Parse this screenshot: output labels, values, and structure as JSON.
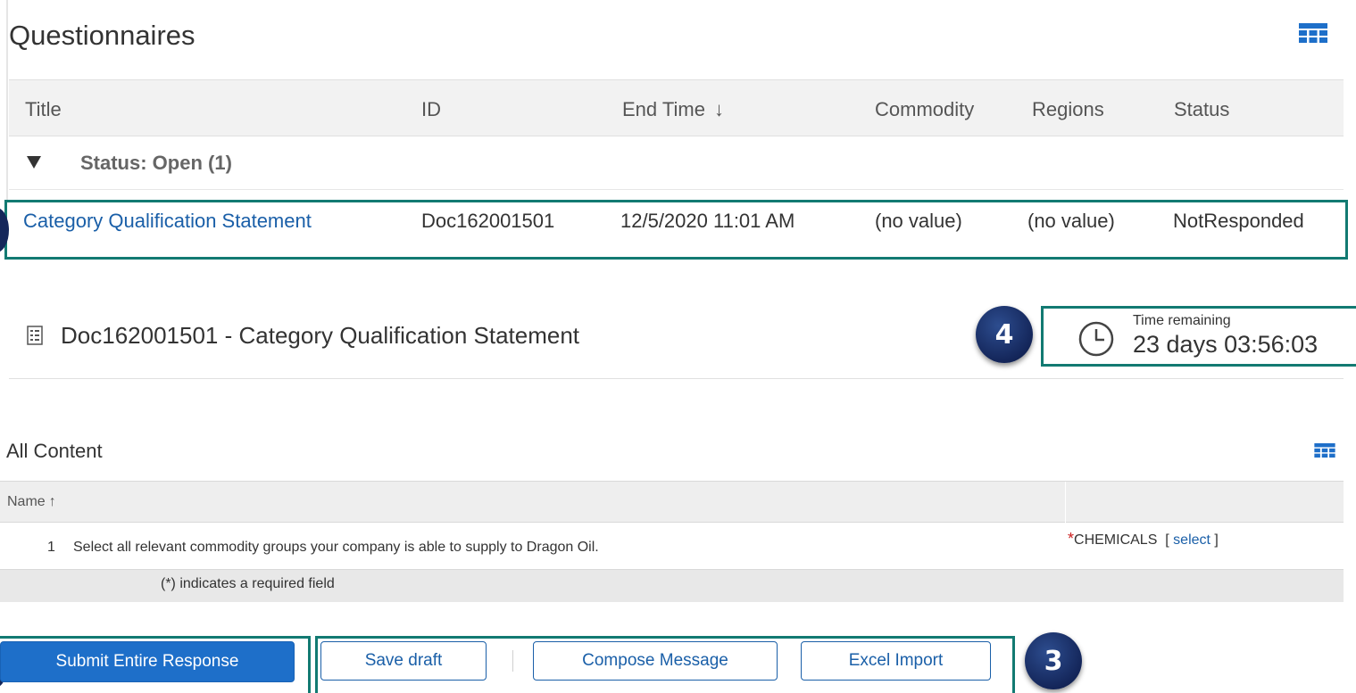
{
  "questionnaires": {
    "title": "Questionnaires",
    "columns": [
      {
        "label": "Title"
      },
      {
        "label": "ID"
      },
      {
        "label": "End Time",
        "sort": "descending"
      },
      {
        "label": "Commodity"
      },
      {
        "label": "Regions"
      },
      {
        "label": "Status"
      }
    ],
    "group": {
      "label": "Status: Open (1)",
      "expanded": true
    },
    "rows": [
      {
        "title": "Category Qualification Statement",
        "id": "Doc162001501",
        "end_time": "12/5/2020 11:01 AM",
        "commodity": "(no value)",
        "regions": "(no value)",
        "status": "NotResponded"
      }
    ]
  },
  "document": {
    "title": "Doc162001501 - Category Qualification Statement",
    "time_remaining_label": "Time remaining",
    "time_remaining_value": "23 days 03:56:03"
  },
  "all_content": {
    "title": "All Content",
    "column_name": "Name",
    "items": [
      {
        "number": "1",
        "question": "Select all relevant commodity groups your company is able to supply to Dragon Oil.",
        "required_marker": "*",
        "answer": "CHEMICALS",
        "select_open": "[",
        "select_label": "select",
        "select_close": "]"
      }
    ],
    "footer_note": "(*) indicates a required field"
  },
  "buttons": {
    "submit": "Submit Entire Response",
    "save_draft": "Save draft",
    "compose_message": "Compose Message",
    "excel_import": "Excel Import"
  },
  "callouts": {
    "badge_3": "3",
    "badge_4": "4"
  },
  "colors": {
    "link": "#1a5fa8",
    "primary_button": "#1e6fc9",
    "highlight_box": "#127a72",
    "badge": "#14265a",
    "required": "#cc1f1f"
  },
  "icons": {
    "table_options": "grid-icon",
    "document": "document-list-icon",
    "time": "clock-icon",
    "sort_desc": "arrow-down-icon",
    "sort_asc": "arrow-up-icon",
    "group_toggle": "caret-down-icon"
  }
}
